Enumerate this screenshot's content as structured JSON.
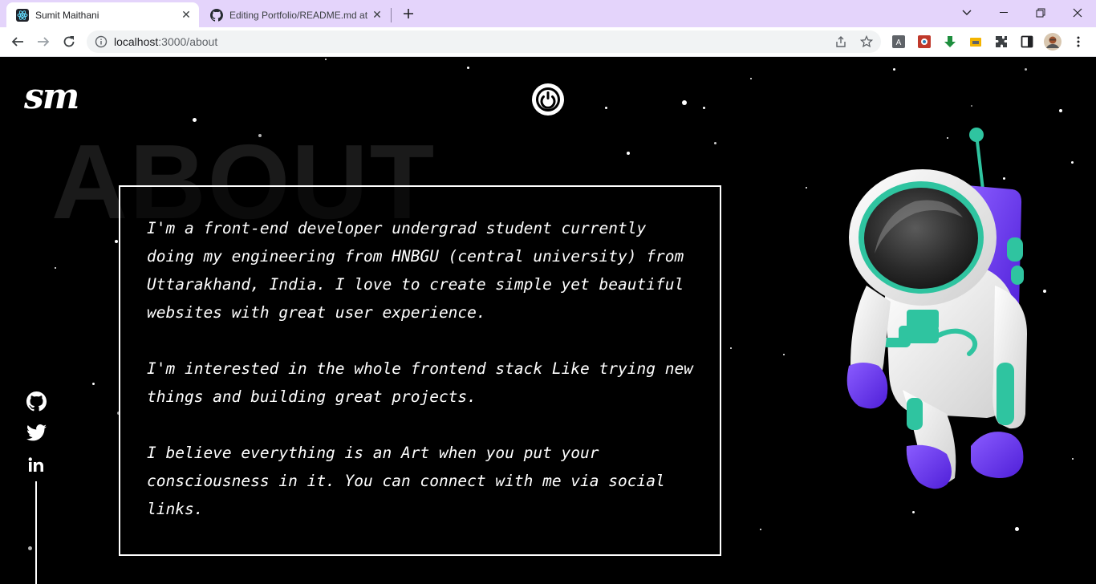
{
  "browser": {
    "tabs": [
      {
        "title": "Sumit Maithani",
        "icon": "react-icon",
        "active": true
      },
      {
        "title": "Editing Portfolio/README.md at",
        "icon": "github-icon",
        "active": false
      }
    ],
    "address": {
      "host": "localhost",
      "path": ":3000/about"
    }
  },
  "page": {
    "logo": "sm",
    "bg_title": "ABOUT",
    "paragraphs": [
      "I'm a front-end developer undergrad student currently doing my engineering from HNBGU (central university) from Uttarakhand, India. I love to create simple yet beautiful websites with great user experience.",
      "I'm interested in the whole frontend stack Like trying new things and building great projects.",
      "I believe everything is an Art when you put your consciousness in it. You can connect with me via social links."
    ],
    "social": [
      "github-icon",
      "twitter-icon",
      "linkedin-icon"
    ],
    "colors": {
      "background": "#000000",
      "text": "#ffffff",
      "tabbar": "#e4d4fb",
      "astronaut_accent": "#6c3cf0",
      "astronaut_trim": "#2fc4a0"
    }
  }
}
